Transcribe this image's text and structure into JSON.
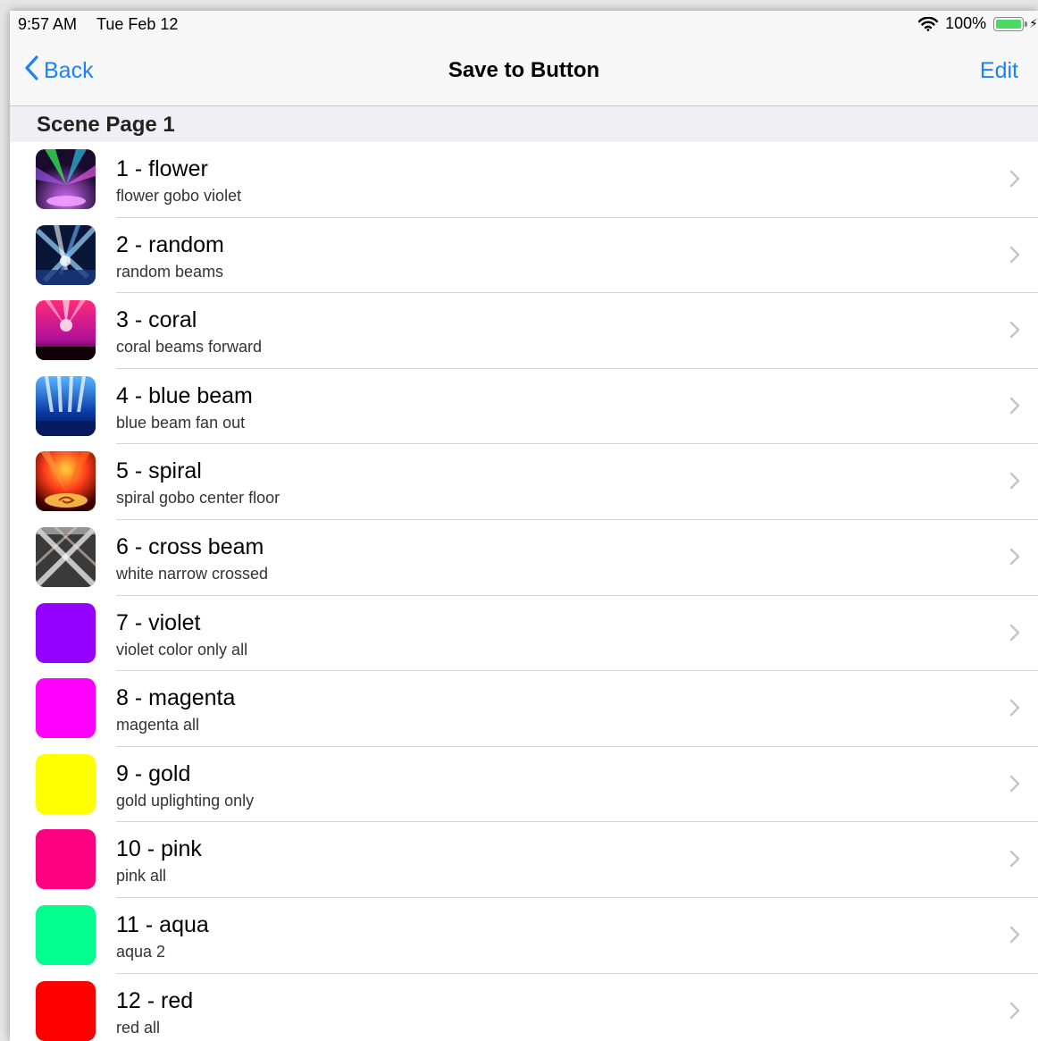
{
  "status": {
    "time": "9:57 AM",
    "date": "Tue Feb 12",
    "battery": "100%"
  },
  "nav": {
    "back_label": "Back",
    "title": "Save to Button",
    "edit_label": "Edit"
  },
  "section": {
    "title": "Scene Page 1"
  },
  "scenes": [
    {
      "title": "1 - flower",
      "subtitle": "flower gobo violet",
      "image": "flower-photo"
    },
    {
      "title": "2 - random",
      "subtitle": "random beams",
      "image": "random-photo"
    },
    {
      "title": "3 - coral",
      "subtitle": "coral beams forward",
      "image": "coral-photo"
    },
    {
      "title": "4 - blue beam",
      "subtitle": "blue beam fan out",
      "image": "blue-beam-photo"
    },
    {
      "title": "5 - spiral",
      "subtitle": "spiral gobo center floor",
      "image": "spiral-photo"
    },
    {
      "title": "6 - cross beam",
      "subtitle": "white narrow crossed",
      "image": "cross-beam-photo"
    },
    {
      "title": "7 - violet",
      "subtitle": "violet color only all",
      "color": "#9400ff"
    },
    {
      "title": "8 - magenta",
      "subtitle": "magenta all",
      "color": "#ff00ff"
    },
    {
      "title": "9 - gold",
      "subtitle": "gold uplighting only",
      "color": "#ffff00"
    },
    {
      "title": "10 - pink",
      "subtitle": "pink all",
      "color": "#ff0080"
    },
    {
      "title": "11 - aqua",
      "subtitle": "aqua 2",
      "color": "#00ff8c"
    },
    {
      "title": "12 - red",
      "subtitle": "red all",
      "color": "#ff0000"
    }
  ],
  "colors": {
    "accent": "#1a82fb",
    "battery_green": "#4cd964"
  }
}
